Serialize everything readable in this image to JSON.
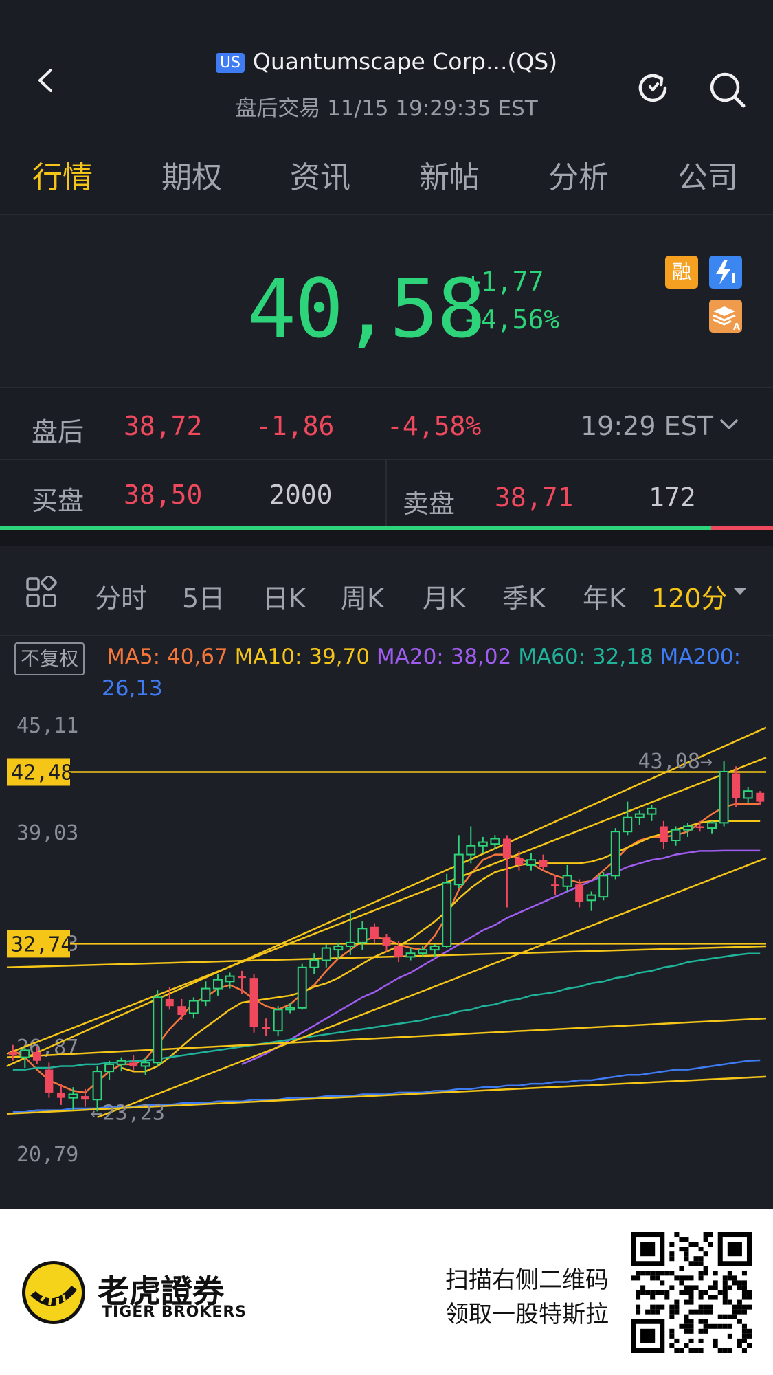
{
  "header": {
    "market_badge": "US",
    "title": "Quantumscape Corp...(QS)",
    "subtitle": "盘后交易 11/15 19:29:35 EST"
  },
  "tabs": [
    "行情",
    "期权",
    "资讯",
    "新帖",
    "分析",
    "公司"
  ],
  "quote": {
    "price": "40,58",
    "change": "+1,77",
    "change_pct": "+4,56%",
    "badge_margin": "融"
  },
  "after_hours": {
    "label": "盘后",
    "price": "38,72",
    "change": "-1,86",
    "change_pct": "-4,58%",
    "time": "19:29 EST"
  },
  "order_book": {
    "bid_label": "买盘",
    "bid_price": "38,50",
    "bid_size": "2000",
    "ask_label": "卖盘",
    "ask_price": "38,71",
    "ask_size": "172",
    "bid_ratio": 0.92
  },
  "kline_tabs": [
    "分时",
    "5日",
    "日K",
    "周K",
    "月K",
    "季K",
    "年K",
    "120分"
  ],
  "chart_toolbar": {
    "adjust_label": "不复权",
    "ma": [
      {
        "label": "MA5: 40,67",
        "color": "#f5763b"
      },
      {
        "label": "MA10: 39,70",
        "color": "#f5c518"
      },
      {
        "label": "MA20: 38,02",
        "color": "#a05cf0"
      },
      {
        "label": "MA60: 32,18",
        "color": "#1fb39a"
      },
      {
        "label": "MA200:",
        "color": "#3f7bf2"
      }
    ],
    "ma200_value": "26,13"
  },
  "chart_data": {
    "type": "candlestick",
    "y_ticks": [
      "45,11",
      "39,03",
      "32,73",
      "26,87",
      "20,79"
    ],
    "y_range": [
      20.79,
      45.11
    ],
    "price_markers": [
      "42,48",
      "32,74"
    ],
    "high_label": "43,08→",
    "low_label": "←23,23",
    "colors": {
      "up": "#2ed47a",
      "down": "#f0485d",
      "trendline": "#f5c518"
    },
    "candles": [
      {
        "o": 26.6,
        "h": 27.0,
        "l": 26.1,
        "c": 26.4
      },
      {
        "o": 26.3,
        "h": 26.9,
        "l": 25.7,
        "c": 26.7
      },
      {
        "o": 26.6,
        "h": 26.9,
        "l": 25.9,
        "c": 26.1
      },
      {
        "o": 25.6,
        "h": 26.0,
        "l": 24.0,
        "c": 24.3
      },
      {
        "o": 24.3,
        "h": 24.8,
        "l": 23.6,
        "c": 24.0
      },
      {
        "o": 24.0,
        "h": 24.6,
        "l": 23.3,
        "c": 24.2
      },
      {
        "o": 24.1,
        "h": 24.5,
        "l": 23.5,
        "c": 23.9
      },
      {
        "o": 23.9,
        "h": 25.8,
        "l": 23.23,
        "c": 25.5
      },
      {
        "o": 25.5,
        "h": 26.1,
        "l": 25.0,
        "c": 25.9
      },
      {
        "o": 25.9,
        "h": 26.3,
        "l": 25.5,
        "c": 26.1
      },
      {
        "o": 26.0,
        "h": 26.4,
        "l": 25.5,
        "c": 25.8
      },
      {
        "o": 25.8,
        "h": 26.3,
        "l": 25.3,
        "c": 26.0
      },
      {
        "o": 26.0,
        "h": 30.1,
        "l": 25.8,
        "c": 29.7
      },
      {
        "o": 29.6,
        "h": 30.3,
        "l": 29.0,
        "c": 29.2
      },
      {
        "o": 29.2,
        "h": 29.6,
        "l": 28.4,
        "c": 28.7
      },
      {
        "o": 28.8,
        "h": 29.7,
        "l": 28.5,
        "c": 29.5
      },
      {
        "o": 29.5,
        "h": 30.6,
        "l": 29.2,
        "c": 30.2
      },
      {
        "o": 30.2,
        "h": 31.0,
        "l": 29.8,
        "c": 30.7
      },
      {
        "o": 30.6,
        "h": 31.1,
        "l": 30.2,
        "c": 30.9
      },
      {
        "o": 30.9,
        "h": 31.2,
        "l": 29.9,
        "c": 30.8
      },
      {
        "o": 30.8,
        "h": 31.0,
        "l": 27.7,
        "c": 28.0
      },
      {
        "o": 28.0,
        "h": 28.5,
        "l": 27.5,
        "c": 27.9
      },
      {
        "o": 27.8,
        "h": 29.2,
        "l": 27.5,
        "c": 29.0
      },
      {
        "o": 29.0,
        "h": 29.4,
        "l": 28.8,
        "c": 29.1
      },
      {
        "o": 29.1,
        "h": 31.6,
        "l": 29.0,
        "c": 31.4
      },
      {
        "o": 31.4,
        "h": 32.2,
        "l": 31.0,
        "c": 31.8
      },
      {
        "o": 31.8,
        "h": 32.7,
        "l": 31.4,
        "c": 32.5
      },
      {
        "o": 32.4,
        "h": 32.8,
        "l": 31.9,
        "c": 32.6
      },
      {
        "o": 32.6,
        "h": 34.6,
        "l": 32.1,
        "c": 32.8
      },
      {
        "o": 32.8,
        "h": 34.0,
        "l": 32.4,
        "c": 33.6
      },
      {
        "o": 33.7,
        "h": 33.9,
        "l": 32.8,
        "c": 33.0
      },
      {
        "o": 33.1,
        "h": 33.3,
        "l": 32.3,
        "c": 32.6
      },
      {
        "o": 32.6,
        "h": 32.9,
        "l": 31.7,
        "c": 32.0
      },
      {
        "o": 32.0,
        "h": 32.5,
        "l": 31.8,
        "c": 32.2
      },
      {
        "o": 32.2,
        "h": 32.6,
        "l": 32.0,
        "c": 32.4
      },
      {
        "o": 32.4,
        "h": 32.7,
        "l": 32.0,
        "c": 32.6
      },
      {
        "o": 32.6,
        "h": 36.7,
        "l": 32.5,
        "c": 36.2
      },
      {
        "o": 36.1,
        "h": 38.9,
        "l": 35.9,
        "c": 37.8
      },
      {
        "o": 37.8,
        "h": 39.4,
        "l": 37.3,
        "c": 38.3
      },
      {
        "o": 38.3,
        "h": 38.8,
        "l": 37.9,
        "c": 38.5
      },
      {
        "o": 38.4,
        "h": 38.9,
        "l": 38.1,
        "c": 38.7
      },
      {
        "o": 38.7,
        "h": 38.9,
        "l": 34.8,
        "c": 37.6
      },
      {
        "o": 37.6,
        "h": 38.0,
        "l": 36.9,
        "c": 37.2
      },
      {
        "o": 37.2,
        "h": 37.9,
        "l": 36.9,
        "c": 37.5
      },
      {
        "o": 37.5,
        "h": 37.8,
        "l": 36.9,
        "c": 37.1
      },
      {
        "o": 36.1,
        "h": 36.6,
        "l": 35.5,
        "c": 36.0
      },
      {
        "o": 36.0,
        "h": 37.2,
        "l": 35.7,
        "c": 36.6
      },
      {
        "o": 36.1,
        "h": 36.4,
        "l": 34.8,
        "c": 35.1
      },
      {
        "o": 35.2,
        "h": 35.7,
        "l": 34.6,
        "c": 35.5
      },
      {
        "o": 35.4,
        "h": 36.8,
        "l": 35.2,
        "c": 36.6
      },
      {
        "o": 36.6,
        "h": 39.3,
        "l": 36.4,
        "c": 39.1
      },
      {
        "o": 39.1,
        "h": 40.8,
        "l": 38.9,
        "c": 39.9
      },
      {
        "o": 39.9,
        "h": 40.3,
        "l": 39.5,
        "c": 40.1
      },
      {
        "o": 40.1,
        "h": 40.6,
        "l": 39.7,
        "c": 40.4
      },
      {
        "o": 39.4,
        "h": 39.7,
        "l": 38.1,
        "c": 38.5
      },
      {
        "o": 38.6,
        "h": 39.4,
        "l": 38.3,
        "c": 39.2
      },
      {
        "o": 39.2,
        "h": 39.6,
        "l": 38.8,
        "c": 39.4
      },
      {
        "o": 39.4,
        "h": 39.7,
        "l": 39.1,
        "c": 39.3
      },
      {
        "o": 39.3,
        "h": 39.7,
        "l": 39.0,
        "c": 39.6
      },
      {
        "o": 39.6,
        "h": 43.08,
        "l": 39.4,
        "c": 42.5
      },
      {
        "o": 42.4,
        "h": 42.8,
        "l": 40.5,
        "c": 41.0
      },
      {
        "o": 41.0,
        "h": 41.6,
        "l": 40.7,
        "c": 41.4
      },
      {
        "o": 41.3,
        "h": 41.4,
        "l": 40.6,
        "c": 40.8
      }
    ],
    "series": [
      {
        "name": "MA5",
        "color": "#f5763b",
        "values": [
          26.7,
          26.3,
          25.6,
          25.0,
          24.7,
          24.4,
          24.3,
          24.9,
          25.5,
          25.9,
          25.9,
          26.2,
          27.0,
          27.9,
          28.6,
          29.4,
          29.7,
          30.2,
          30.4,
          30.1,
          29.6,
          29.2,
          29.0,
          29.3,
          29.9,
          30.4,
          31.2,
          31.9,
          32.4,
          32.9,
          33.1,
          33.0,
          32.7,
          32.5,
          32.4,
          33.2,
          34.3,
          35.8,
          36.7,
          37.5,
          37.8,
          37.8,
          37.6,
          37.3,
          36.9,
          36.6,
          36.4,
          36.2,
          36.3,
          36.9,
          37.5,
          38.2,
          38.6,
          38.8,
          38.8,
          38.9,
          39.1,
          39.6,
          40.1,
          40.5,
          40.67,
          40.67,
          40.67
        ]
      },
      {
        "name": "MA10",
        "color": "#f5c518",
        "values": [
          null,
          null,
          null,
          null,
          null,
          null,
          null,
          null,
          null,
          25.7,
          25.5,
          25.5,
          25.8,
          26.3,
          26.9,
          27.5,
          28.0,
          28.5,
          29.0,
          29.4,
          29.5,
          29.6,
          29.7,
          29.8,
          30.0,
          30.3,
          30.5,
          30.8,
          31.2,
          31.6,
          32.0,
          32.3,
          32.6,
          33.0,
          33.5,
          34.0,
          34.6,
          35.3,
          35.9,
          36.4,
          36.8,
          37.0,
          37.2,
          37.3,
          37.3,
          37.3,
          37.3,
          37.3,
          37.4,
          37.6,
          37.9,
          38.2,
          38.5,
          38.8,
          39.0,
          39.2,
          39.4,
          39.6,
          39.7,
          39.7,
          39.7,
          39.7,
          39.7
        ]
      },
      {
        "name": "MA20",
        "color": "#a05cf0",
        "values": [
          null,
          null,
          null,
          null,
          null,
          null,
          null,
          null,
          null,
          null,
          null,
          null,
          null,
          null,
          null,
          null,
          null,
          null,
          null,
          25.9,
          26.2,
          26.5,
          26.9,
          27.3,
          27.7,
          28.1,
          28.5,
          28.9,
          29.3,
          29.7,
          30.0,
          30.4,
          30.8,
          31.1,
          31.5,
          31.9,
          32.3,
          32.7,
          33.1,
          33.5,
          33.8,
          34.2,
          34.5,
          34.8,
          35.1,
          35.4,
          35.7,
          36.0,
          36.3,
          36.6,
          36.8,
          37.1,
          37.3,
          37.5,
          37.6,
          37.8,
          37.9,
          38.0,
          38.0,
          38.02,
          38.02,
          38.02,
          38.02
        ]
      },
      {
        "name": "MA60",
        "color": "#1fb39a",
        "values": [
          25.6,
          25.6,
          25.7,
          25.7,
          25.8,
          25.8,
          25.9,
          25.9,
          26.0,
          26.0,
          26.1,
          26.1,
          26.2,
          26.3,
          26.4,
          26.5,
          26.6,
          26.7,
          26.8,
          26.9,
          27.0,
          27.1,
          27.2,
          27.3,
          27.4,
          27.5,
          27.6,
          27.7,
          27.8,
          27.9,
          28.0,
          28.1,
          28.2,
          28.3,
          28.4,
          28.6,
          28.7,
          28.9,
          29.0,
          29.2,
          29.3,
          29.5,
          29.6,
          29.8,
          29.9,
          30.0,
          30.2,
          30.3,
          30.5,
          30.6,
          30.8,
          30.9,
          31.1,
          31.2,
          31.4,
          31.5,
          31.7,
          31.8,
          31.9,
          32.0,
          32.1,
          32.18,
          32.18
        ]
      },
      {
        "name": "MA200",
        "color": "#3f7bf2",
        "values": [
          23.2,
          23.2,
          23.3,
          23.3,
          23.3,
          23.4,
          23.4,
          23.4,
          23.5,
          23.5,
          23.5,
          23.6,
          23.6,
          23.6,
          23.7,
          23.7,
          23.7,
          23.8,
          23.8,
          23.8,
          23.9,
          23.9,
          23.9,
          24.0,
          24.0,
          24.0,
          24.1,
          24.1,
          24.1,
          24.2,
          24.2,
          24.2,
          24.3,
          24.3,
          24.3,
          24.4,
          24.4,
          24.5,
          24.5,
          24.6,
          24.6,
          24.7,
          24.7,
          24.8,
          24.8,
          24.9,
          24.9,
          25.0,
          25.0,
          25.1,
          25.2,
          25.3,
          25.3,
          25.4,
          25.5,
          25.6,
          25.6,
          25.7,
          25.8,
          25.9,
          26.0,
          26.1,
          26.13
        ]
      }
    ],
    "trendlines": [
      {
        "from": [
          0,
          25.8
        ],
        "to": [
          62,
          45.0
        ]
      },
      {
        "from": [
          0,
          26.5
        ],
        "to": [
          62,
          43.3
        ]
      },
      {
        "from": [
          7,
          22.9
        ],
        "to": [
          62,
          37.6
        ]
      },
      {
        "from": [
          0,
          31.4
        ],
        "to": [
          62,
          32.6
        ]
      },
      {
        "from": [
          0,
          26.3
        ],
        "to": [
          62,
          28.5
        ]
      },
      {
        "from": [
          0,
          23.1
        ],
        "to": [
          62,
          25.2
        ]
      },
      {
        "from": [
          0,
          42.48
        ],
        "to": [
          62,
          42.48
        ]
      },
      {
        "from": [
          0,
          32.74
        ],
        "to": [
          62,
          32.74
        ]
      }
    ]
  },
  "footer": {
    "brand_cn": "老虎證券",
    "brand_en": "TIGER BROKERS",
    "promo_line1": "扫描右侧二维码",
    "promo_line2": "领取一股特斯拉"
  }
}
